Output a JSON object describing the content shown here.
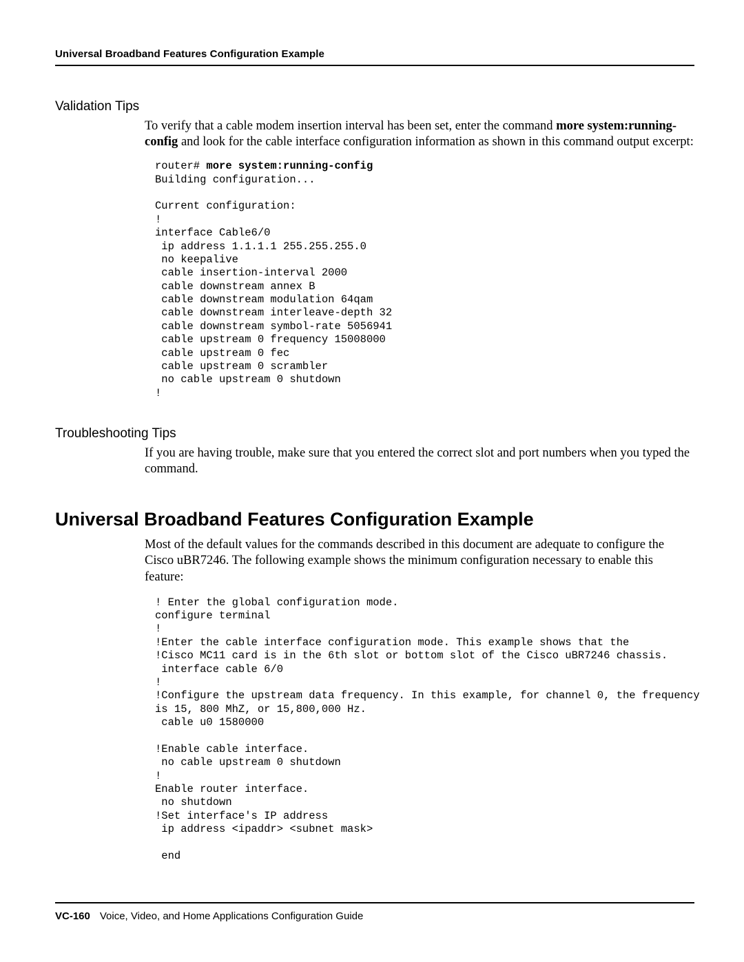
{
  "header": {
    "running_title": "Universal Broadband Features Configuration Example"
  },
  "sections": {
    "validation": {
      "heading": "Validation Tips",
      "para_prefix": "To verify that a cable modem insertion interval has been set, enter the command ",
      "para_cmd1": "more system:running-config",
      "para_mid": " and look for the cable interface configuration information as shown in this command output excerpt:",
      "code_prompt": "router# ",
      "code_cmd": "more system:running-config",
      "code_body": "Building configuration...\n\nCurrent configuration:\n!\ninterface Cable6/0\n ip address 1.1.1.1 255.255.255.0\n no keepalive\n cable insertion-interval 2000\n cable downstream annex B\n cable downstream modulation 64qam\n cable downstream interleave-depth 32\n cable downstream symbol-rate 5056941\n cable upstream 0 frequency 15008000\n cable upstream 0 fec\n cable upstream 0 scrambler\n no cable upstream 0 shutdown\n!"
    },
    "troubleshooting": {
      "heading": "Troubleshooting Tips",
      "para": "If you are having trouble, make sure that you entered the correct slot and port numbers when you typed the command."
    },
    "example": {
      "heading": "Universal Broadband Features Configuration Example",
      "para": "Most of the default values for the commands described in this document are adequate to configure the Cisco uBR7246. The following example shows the minimum configuration necessary to enable this feature:",
      "code": "! Enter the global configuration mode.\nconfigure terminal\n!\n!Enter the cable interface configuration mode. This example shows that the\n!Cisco MC11 card is in the 6th slot or bottom slot of the Cisco uBR7246 chassis.\n interface cable 6/0\n!\n!Configure the upstream data frequency. In this example, for channel 0, the frequency\nis 15, 800 MhZ, or 15,800,000 Hz.\n cable u0 1580000\n\n!Enable cable interface.\n no cable upstream 0 shutdown\n!\nEnable router interface.\n no shutdown\n!Set interface's IP address\n ip address <ipaddr> <subnet mask>\n\n end"
    }
  },
  "footer": {
    "page_number": "VC-160",
    "guide_title": "Voice, Video, and Home Applications Configuration Guide"
  }
}
